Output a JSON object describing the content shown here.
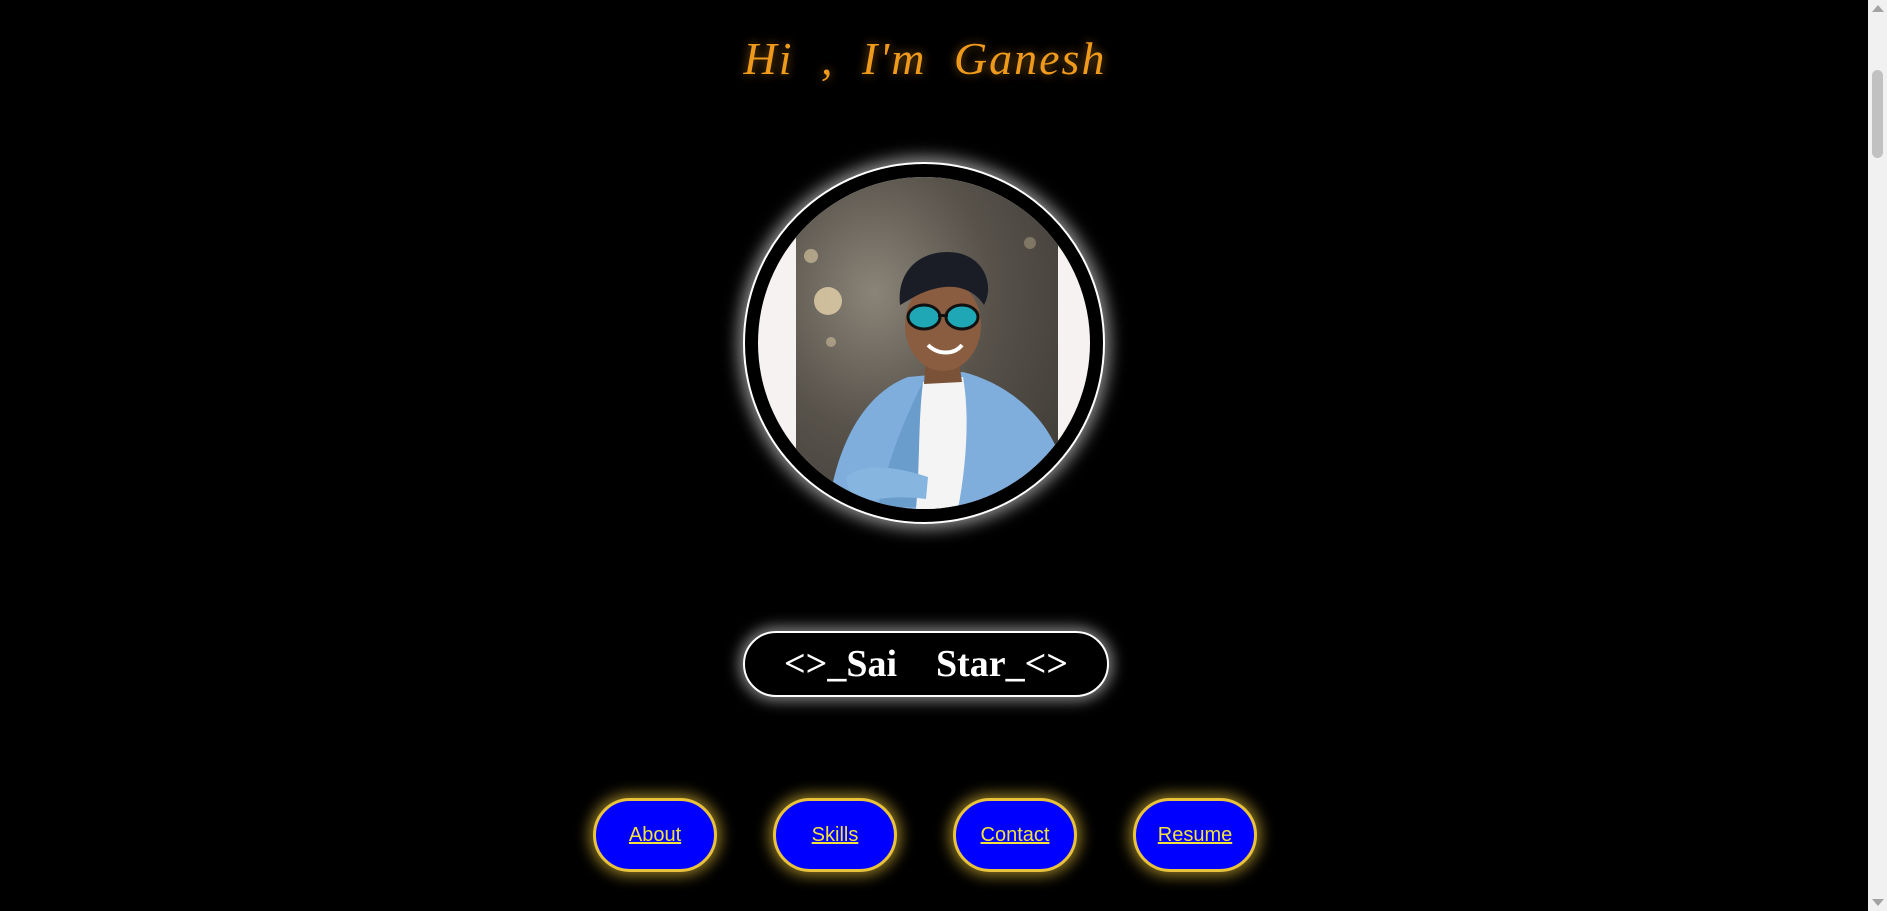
{
  "header": {
    "greeting": "Hi ,  I'm   Ganesh"
  },
  "profile": {
    "photo_icon": "profile-photo",
    "name_tag": "<>_Sai  Star_<>"
  },
  "nav": {
    "items": [
      {
        "label": "About"
      },
      {
        "label": "Skills"
      },
      {
        "label": "Contact"
      },
      {
        "label": "Resume"
      }
    ]
  },
  "colors": {
    "background": "#000000",
    "greeting": "#f09a1c",
    "button_fill": "#0000ff",
    "button_border": "#e8c23a",
    "button_text": "#f2e23a"
  }
}
